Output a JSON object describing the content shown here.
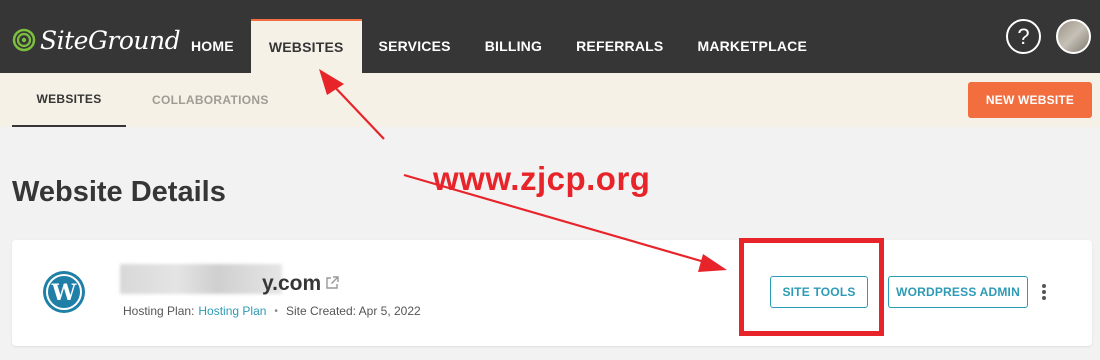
{
  "header": {
    "logo_text": "SiteGround",
    "nav": [
      "HOME",
      "WEBSITES",
      "SERVICES",
      "BILLING",
      "REFERRALS",
      "MARKETPLACE"
    ],
    "active_nav": "WEBSITES",
    "help_label": "?"
  },
  "subnav": {
    "tabs": [
      "WEBSITES",
      "COLLABORATIONS"
    ],
    "active_tab": "WEBSITES",
    "new_website_label": "NEW WEBSITE"
  },
  "page": {
    "title": "Website Details"
  },
  "site_card": {
    "domain": "y.com",
    "hosting_plan_label": "Hosting Plan:",
    "hosting_plan_value": "Hosting Plan",
    "site_created_label": "Site Created: Apr 5, 2022",
    "site_tools_label": "SITE TOOLS",
    "wp_admin_label": "WORDPRESS ADMIN"
  },
  "annotation": {
    "watermark": "www.zjcp.org"
  },
  "colors": {
    "topbar": "#363636",
    "subbar": "#f6f1e7",
    "accent_orange": "#f36e3f",
    "link_teal": "#2d9bb5",
    "annotation_red": "#e8242b"
  }
}
